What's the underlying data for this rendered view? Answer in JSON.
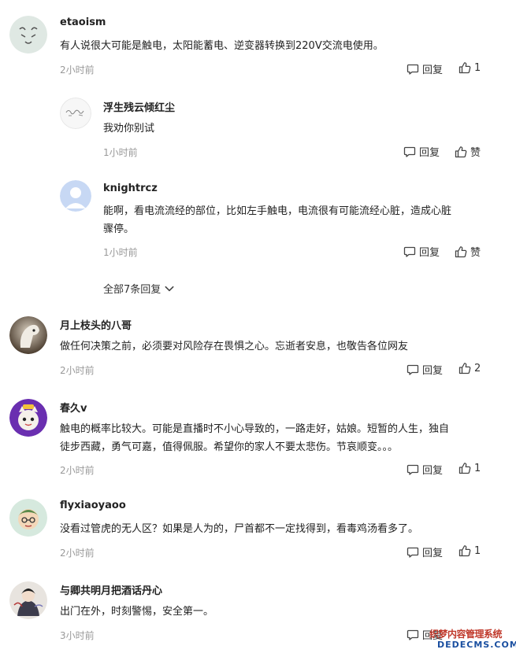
{
  "comments": [
    {
      "username": "etaoism",
      "content": "有人说很大可能是触电，太阳能蓄电、逆变器转换到220V交流电使用。",
      "time": "2小时前",
      "reply_label": "回复",
      "like_label": "1",
      "replies": [
        {
          "username": "浮生残云倾红尘",
          "content": "我劝你别试",
          "time": "1小时前",
          "reply_label": "回复",
          "like_label": "赞"
        },
        {
          "username": "knightrcz",
          "content_line1": "能啊，看电流流经的部位，比如左手触电，电流很有可能流经心脏，造成心脏",
          "content_line2": "骤停。",
          "time": "1小时前",
          "reply_label": "回复",
          "like_label": "赞"
        }
      ],
      "expand_label": "全部7条回复"
    },
    {
      "username": "月上枝头的八哥",
      "content": "做任何决策之前，必须要对风险存在畏惧之心。忘逝者安息，也敬告各位网友",
      "time": "2小时前",
      "reply_label": "回复",
      "like_label": "2"
    },
    {
      "username": "春久v",
      "content_line1": "触电的概率比较大。可能是直播时不小心导致的，一路走好，姑娘。短暂的人生，独自",
      "content_line2": "徒步西藏，勇气可嘉，值得佩服。希望你的家人不要太悲伤。节哀顺变。。。",
      "time": "2小时前",
      "reply_label": "回复",
      "like_label": "1"
    },
    {
      "username": "flyxiaoyaoo",
      "content": "没看过管虎的无人区？如果是人为的，尸首都不一定找得到，看毒鸡汤看多了。",
      "time": "2小时前",
      "reply_label": "回复",
      "like_label": "1"
    },
    {
      "username": "与卿共明月把酒话丹心",
      "content": "出门在外，时刻警惕，安全第一。",
      "time": "3小时前",
      "reply_label": "回复"
    }
  ],
  "watermark": {
    "line1": "织梦内容管理系统",
    "line2": "DEDECMS.COM"
  }
}
